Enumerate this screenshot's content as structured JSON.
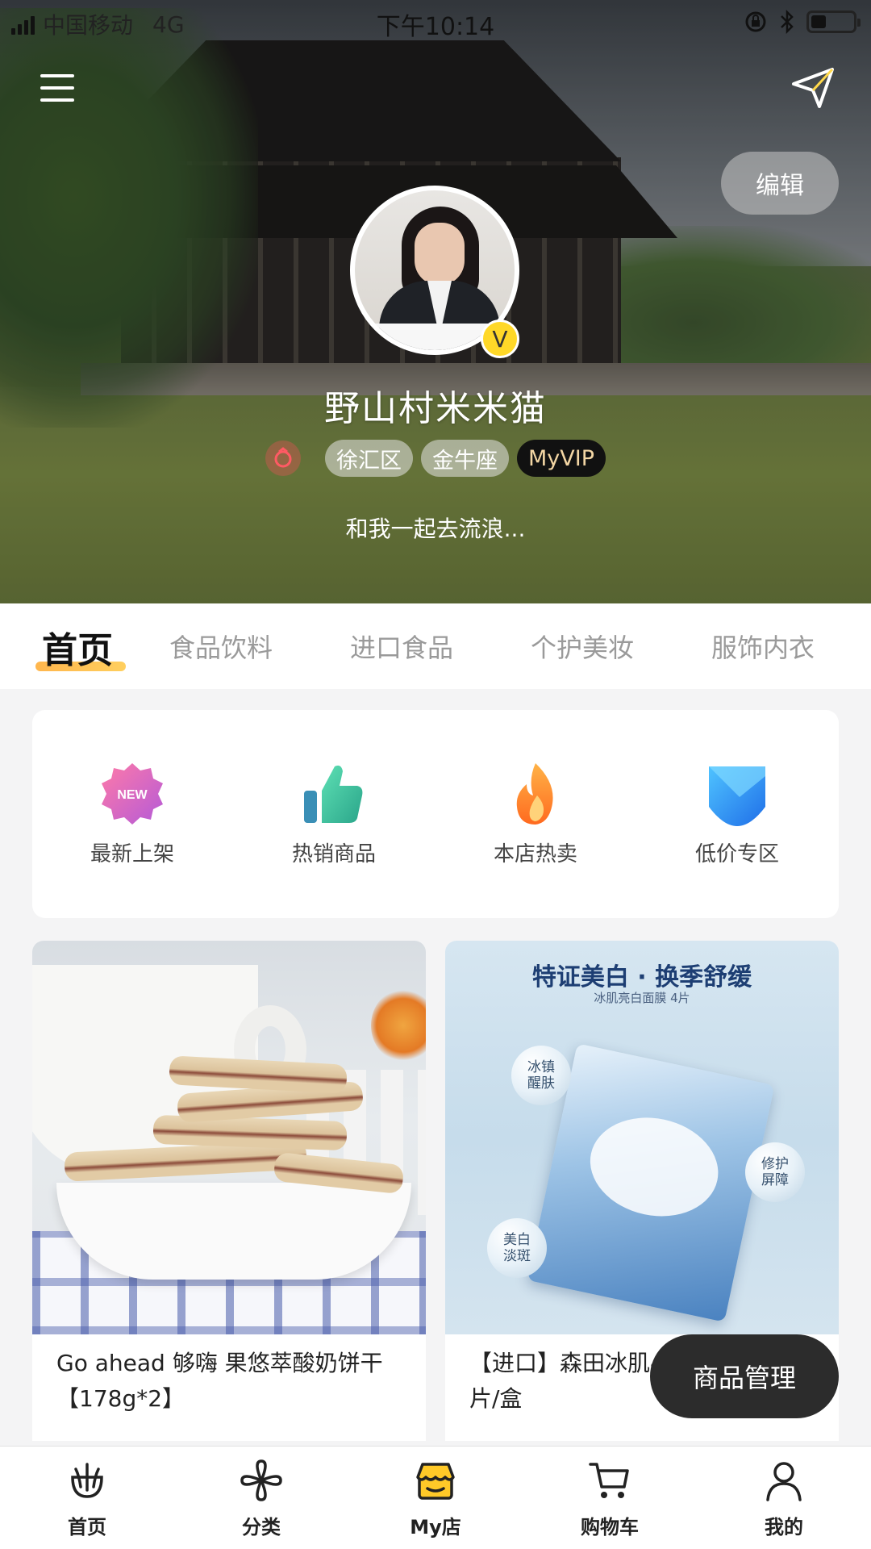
{
  "status_bar": {
    "carrier": "中国移动",
    "network": "4G",
    "time": "下午10:14",
    "battery_level": 0.35
  },
  "header": {
    "edit_label": "编辑",
    "username": "野山村米米猫",
    "verified_badge": "V",
    "tags": [
      "徐汇区",
      "金牛座"
    ],
    "vip_tag": "MyVIP",
    "bio": "和我一起去流浪..."
  },
  "tabs": [
    {
      "label": "首页",
      "active": true
    },
    {
      "label": "食品饮料",
      "active": false
    },
    {
      "label": "进口食品",
      "active": false
    },
    {
      "label": "个护美妆",
      "active": false
    },
    {
      "label": "服饰内衣",
      "active": false
    }
  ],
  "shortcuts": [
    {
      "label": "最新上架",
      "icon": "new-badge-icon",
      "badge_text": "NEW"
    },
    {
      "label": "热销商品",
      "icon": "thumbs-up-icon"
    },
    {
      "label": "本店热卖",
      "icon": "flame-icon"
    },
    {
      "label": "低价专区",
      "icon": "low-price-icon"
    }
  ],
  "products": [
    {
      "title": "Go ahead 够嗨 果悠萃酸奶饼干【178g*2】"
    },
    {
      "title": "【进口】森田冰肌4片/盒",
      "ad": {
        "headline": "特证美白 · 换季舒缓",
        "subline": "冰肌亮白面膜 4片",
        "bubbles": [
          "冰镇\n醒肤",
          "修护\n屏障",
          "美白\n淡斑"
        ]
      }
    }
  ],
  "fab_label": "商品管理",
  "bottom_nav": [
    {
      "label": "首页",
      "icon": "home-sprout-icon"
    },
    {
      "label": "分类",
      "icon": "category-flower-icon"
    },
    {
      "label": "My店",
      "icon": "store-icon",
      "active": true
    },
    {
      "label": "购物车",
      "icon": "cart-icon"
    },
    {
      "label": "我的",
      "icon": "profile-icon"
    }
  ],
  "colors": {
    "tab_underline": "#ffc04f",
    "vip_text": "#f3d6a4",
    "store_icon_accent": "#ffc928",
    "fab_bg": "#2c2c2c"
  }
}
